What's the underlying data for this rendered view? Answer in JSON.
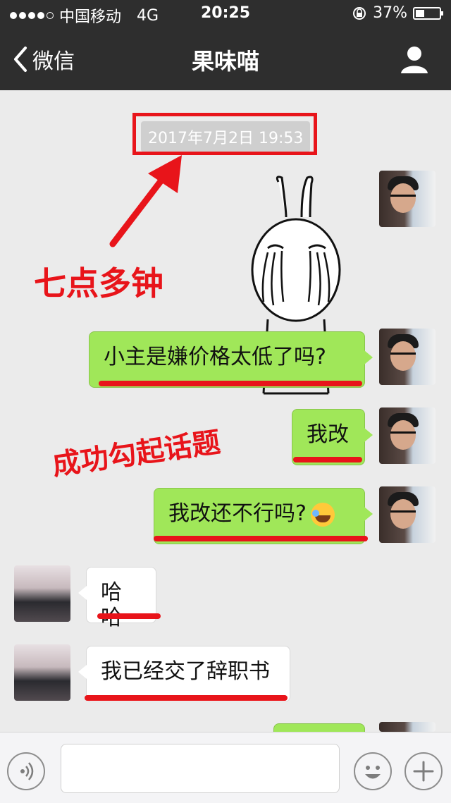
{
  "status_bar": {
    "carrier": "中国移动",
    "network": "4G",
    "time": "20:25",
    "battery": "37%",
    "battery_level": 0.37
  },
  "nav": {
    "back_label": "微信",
    "title": "果味喵"
  },
  "chat": {
    "timestamp": "2017年7月2日 19:53",
    "messages": [
      {
        "from": "me",
        "text": "小主是嫌价格太低了吗?"
      },
      {
        "from": "me",
        "text": "我改"
      },
      {
        "from": "me",
        "text": "我改还不行吗?"
      },
      {
        "from": "her",
        "text": "哈哈"
      },
      {
        "from": "her",
        "text": "我已经交了辞职书"
      }
    ]
  },
  "annotations": {
    "time_note": "七点多钟",
    "topic_note": "成功勾起话题"
  },
  "colors": {
    "accent_red": "#e8141a",
    "my_bubble": "#a0e759",
    "nav_bg": "#2e2e2e",
    "chat_bg": "#ebebeb"
  },
  "icons": [
    "signal-dots-icon",
    "back-chevron-icon",
    "profile-icon",
    "voice-icon",
    "emoji-icon",
    "plus-icon",
    "rotation-lock-icon",
    "battery-icon"
  ]
}
